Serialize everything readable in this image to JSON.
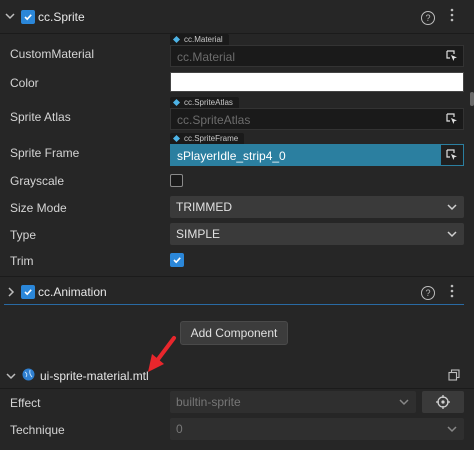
{
  "sprite_component": {
    "title": "cc.Sprite",
    "help": "?",
    "props": {
      "custom_material": {
        "label": "CustomMaterial",
        "tag": "cc.Material",
        "value": "cc.Material"
      },
      "color": {
        "label": "Color",
        "value": "#ffffff"
      },
      "sprite_atlas": {
        "label": "Sprite Atlas",
        "tag": "cc.SpriteAtlas",
        "value": "cc.SpriteAtlas"
      },
      "sprite_frame": {
        "label": "Sprite Frame",
        "tag": "cc.SpriteFrame",
        "value": "sPlayerIdle_strip4_0"
      },
      "grayscale": {
        "label": "Grayscale",
        "checked": false
      },
      "size_mode": {
        "label": "Size Mode",
        "value": "TRIMMED"
      },
      "type": {
        "label": "Type",
        "value": "SIMPLE"
      },
      "trim": {
        "label": "Trim",
        "checked": true
      }
    }
  },
  "animation_component": {
    "title": "cc.Animation",
    "help": "?"
  },
  "add_component_label": "Add Component",
  "material_section": {
    "title": "ui-sprite-material.mtl",
    "effect": {
      "label": "Effect",
      "value": "builtin-sprite"
    },
    "technique": {
      "label": "Technique",
      "value": "0"
    }
  },
  "colors": {
    "accent": "#2b87d9",
    "selection": "#2b7fa0",
    "annotation_arrow": "#e8262c"
  }
}
